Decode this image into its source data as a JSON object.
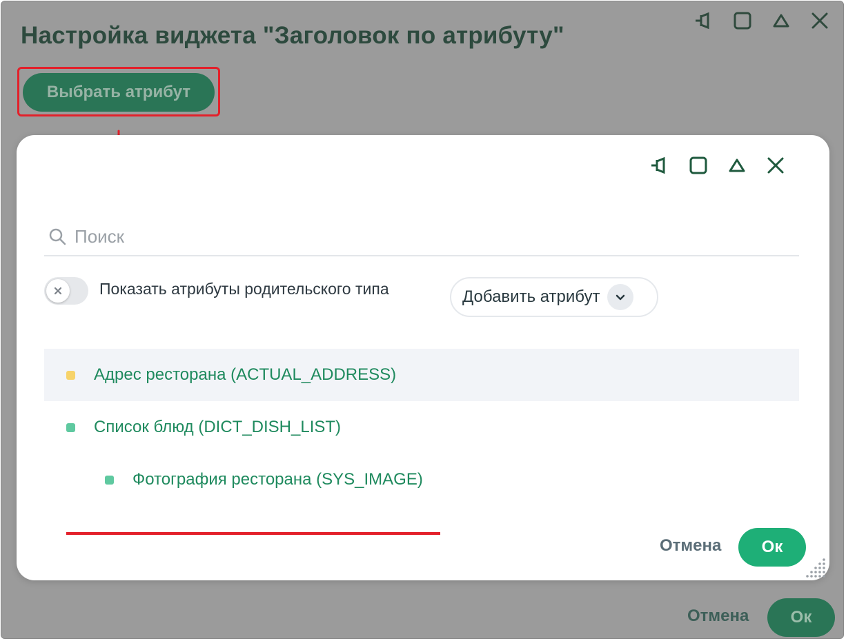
{
  "outer_window": {
    "title": "Настройка виджета \"Заголовок по атрибуту\"",
    "select_attribute_button": "Выбрать атрибут",
    "cancel_label": "Отмена",
    "ok_label": "Ок",
    "controls": [
      "pin-icon",
      "maximize-icon",
      "collapse-icon",
      "close-icon"
    ]
  },
  "dialog": {
    "controls": [
      "pin-icon",
      "maximize-icon",
      "collapse-icon",
      "close-icon"
    ],
    "search": {
      "placeholder": "Поиск",
      "value": ""
    },
    "parent_toggle": {
      "label": "Показать атрибуты родительского типа",
      "on": false
    },
    "add_attribute_label": "Добавить атрибут",
    "attributes": [
      {
        "label": "Адрес ресторана (ACTUAL_ADDRESS)",
        "dot_color": "#f7d36a",
        "selected": true,
        "expandable": false
      },
      {
        "label": "Список блюд (DICT_DISH_LIST)",
        "dot_color": "#5fc9a0",
        "selected": false,
        "expandable": false
      },
      {
        "label": "Фотография ресторана (SYS_IMAGE)",
        "dot_color": "#5fc9a0",
        "selected": false,
        "expandable": true
      }
    ],
    "cancel_label": "Отмена",
    "ok_label": "Ок"
  },
  "colors": {
    "accent_green": "#1eaf77",
    "annotation_red": "#e3202a",
    "overlay_gray": "#9b9b9b"
  }
}
